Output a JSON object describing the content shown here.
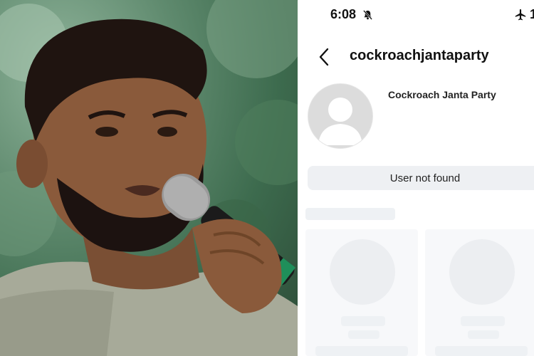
{
  "status_bar": {
    "time": "6:08",
    "icons": [
      "bell-off-icon",
      "airplane-icon"
    ],
    "trailing_digit": "1"
  },
  "profile": {
    "username": "cockroachjantaparty",
    "display_name": "Cockroach Janta Party",
    "status_message": "User not found",
    "avatar": "default-avatar-icon"
  },
  "colors": {
    "skeleton": "#eef1f4",
    "status_bar_bg": "#eef0f3",
    "text": "#111111"
  }
}
